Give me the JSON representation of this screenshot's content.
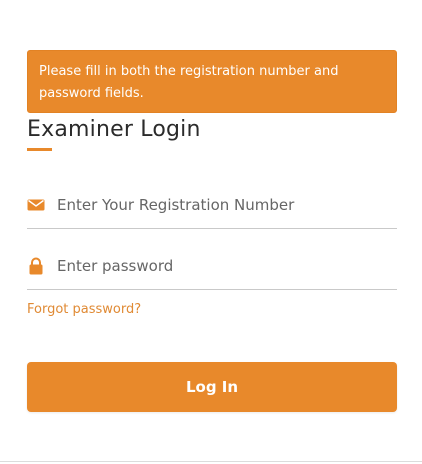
{
  "alert": {
    "message": "Please fill in both the registration number and password fields."
  },
  "form": {
    "title": "Examiner Login",
    "registration": {
      "placeholder": "Enter Your Registration Number",
      "value": "",
      "icon": "envelope-icon"
    },
    "password": {
      "placeholder": "Enter password",
      "value": "",
      "icon": "lock-icon"
    },
    "forgot_label": "Forgot password?",
    "login_label": "Log In"
  },
  "colors": {
    "accent": "#e8892b",
    "text": "#2b2b2b",
    "placeholder": "#666666",
    "divider": "#c9c9c9"
  }
}
